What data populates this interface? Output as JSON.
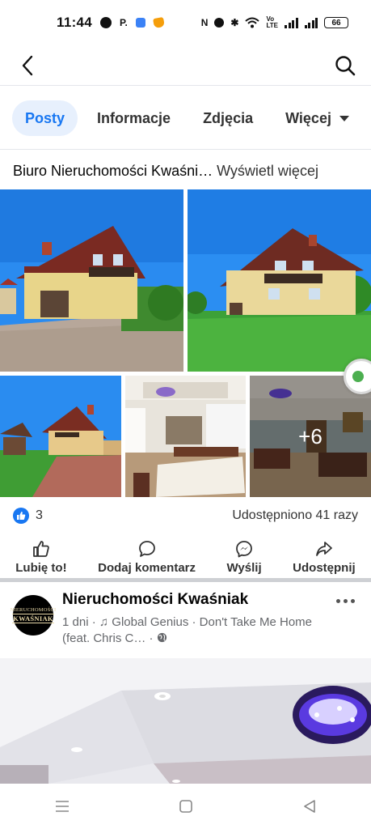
{
  "status_bar": {
    "time": "11:44",
    "p_label": "P.",
    "network_label": "Vo\nLTE",
    "battery": "66"
  },
  "app_bar": {
    "back_icon": "arrow-left-icon",
    "search_icon": "search-icon"
  },
  "tabs": [
    {
      "label": "Posty",
      "active": true
    },
    {
      "label": "Informacje",
      "active": false
    },
    {
      "label": "Zdjęcia",
      "active": false
    },
    {
      "label": "Więcej",
      "active": false
    }
  ],
  "album": {
    "name": "Biuro Nieruchomości Kwaśni…",
    "more": "Wyświetl więcej"
  },
  "photos": {
    "more_count": "+6"
  },
  "reactions": {
    "count": "3",
    "shares": "Udostępniono 41 razy"
  },
  "actions": [
    {
      "label": "Lubię to!",
      "icon": "thumbs-up-icon"
    },
    {
      "label": "Dodaj komentarz",
      "icon": "comment-icon"
    },
    {
      "label": "Wyślij",
      "icon": "messenger-icon"
    },
    {
      "label": "Udostępnij",
      "icon": "share-icon"
    }
  ],
  "post": {
    "page_name": "Nieruchomości Kwaśniak",
    "avatar_line1": "NIERUCHOMOŚCI",
    "avatar_line2": "KWAŚNIAK",
    "time": "1 dni",
    "music": "Global Genius · Don't Take Me Home (feat. Chris C…",
    "separator": "·"
  },
  "colors": {
    "accent": "#1877f2",
    "tab_active_bg": "#e7f0fd",
    "divider": "#ced0d4"
  }
}
